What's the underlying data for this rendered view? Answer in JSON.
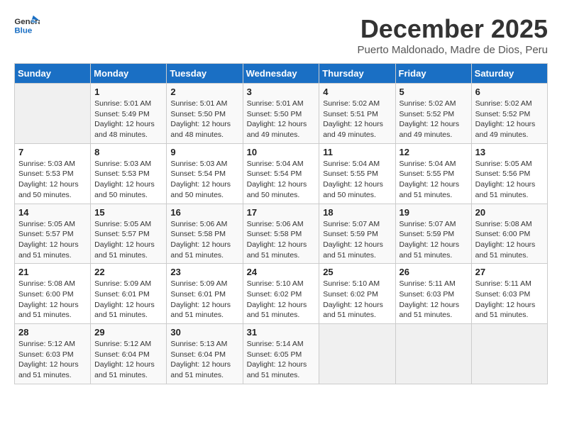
{
  "header": {
    "logo_line1": "General",
    "logo_line2": "Blue",
    "month": "December 2025",
    "location": "Puerto Maldonado, Madre de Dios, Peru"
  },
  "days_of_week": [
    "Sunday",
    "Monday",
    "Tuesday",
    "Wednesday",
    "Thursday",
    "Friday",
    "Saturday"
  ],
  "weeks": [
    [
      {
        "day": "",
        "info": ""
      },
      {
        "day": "1",
        "info": "Sunrise: 5:01 AM\nSunset: 5:49 PM\nDaylight: 12 hours\nand 48 minutes."
      },
      {
        "day": "2",
        "info": "Sunrise: 5:01 AM\nSunset: 5:50 PM\nDaylight: 12 hours\nand 48 minutes."
      },
      {
        "day": "3",
        "info": "Sunrise: 5:01 AM\nSunset: 5:50 PM\nDaylight: 12 hours\nand 49 minutes."
      },
      {
        "day": "4",
        "info": "Sunrise: 5:02 AM\nSunset: 5:51 PM\nDaylight: 12 hours\nand 49 minutes."
      },
      {
        "day": "5",
        "info": "Sunrise: 5:02 AM\nSunset: 5:52 PM\nDaylight: 12 hours\nand 49 minutes."
      },
      {
        "day": "6",
        "info": "Sunrise: 5:02 AM\nSunset: 5:52 PM\nDaylight: 12 hours\nand 49 minutes."
      }
    ],
    [
      {
        "day": "7",
        "info": "Sunrise: 5:03 AM\nSunset: 5:53 PM\nDaylight: 12 hours\nand 50 minutes."
      },
      {
        "day": "8",
        "info": "Sunrise: 5:03 AM\nSunset: 5:53 PM\nDaylight: 12 hours\nand 50 minutes."
      },
      {
        "day": "9",
        "info": "Sunrise: 5:03 AM\nSunset: 5:54 PM\nDaylight: 12 hours\nand 50 minutes."
      },
      {
        "day": "10",
        "info": "Sunrise: 5:04 AM\nSunset: 5:54 PM\nDaylight: 12 hours\nand 50 minutes."
      },
      {
        "day": "11",
        "info": "Sunrise: 5:04 AM\nSunset: 5:55 PM\nDaylight: 12 hours\nand 50 minutes."
      },
      {
        "day": "12",
        "info": "Sunrise: 5:04 AM\nSunset: 5:55 PM\nDaylight: 12 hours\nand 51 minutes."
      },
      {
        "day": "13",
        "info": "Sunrise: 5:05 AM\nSunset: 5:56 PM\nDaylight: 12 hours\nand 51 minutes."
      }
    ],
    [
      {
        "day": "14",
        "info": "Sunrise: 5:05 AM\nSunset: 5:57 PM\nDaylight: 12 hours\nand 51 minutes."
      },
      {
        "day": "15",
        "info": "Sunrise: 5:05 AM\nSunset: 5:57 PM\nDaylight: 12 hours\nand 51 minutes."
      },
      {
        "day": "16",
        "info": "Sunrise: 5:06 AM\nSunset: 5:58 PM\nDaylight: 12 hours\nand 51 minutes."
      },
      {
        "day": "17",
        "info": "Sunrise: 5:06 AM\nSunset: 5:58 PM\nDaylight: 12 hours\nand 51 minutes."
      },
      {
        "day": "18",
        "info": "Sunrise: 5:07 AM\nSunset: 5:59 PM\nDaylight: 12 hours\nand 51 minutes."
      },
      {
        "day": "19",
        "info": "Sunrise: 5:07 AM\nSunset: 5:59 PM\nDaylight: 12 hours\nand 51 minutes."
      },
      {
        "day": "20",
        "info": "Sunrise: 5:08 AM\nSunset: 6:00 PM\nDaylight: 12 hours\nand 51 minutes."
      }
    ],
    [
      {
        "day": "21",
        "info": "Sunrise: 5:08 AM\nSunset: 6:00 PM\nDaylight: 12 hours\nand 51 minutes."
      },
      {
        "day": "22",
        "info": "Sunrise: 5:09 AM\nSunset: 6:01 PM\nDaylight: 12 hours\nand 51 minutes."
      },
      {
        "day": "23",
        "info": "Sunrise: 5:09 AM\nSunset: 6:01 PM\nDaylight: 12 hours\nand 51 minutes."
      },
      {
        "day": "24",
        "info": "Sunrise: 5:10 AM\nSunset: 6:02 PM\nDaylight: 12 hours\nand 51 minutes."
      },
      {
        "day": "25",
        "info": "Sunrise: 5:10 AM\nSunset: 6:02 PM\nDaylight: 12 hours\nand 51 minutes."
      },
      {
        "day": "26",
        "info": "Sunrise: 5:11 AM\nSunset: 6:03 PM\nDaylight: 12 hours\nand 51 minutes."
      },
      {
        "day": "27",
        "info": "Sunrise: 5:11 AM\nSunset: 6:03 PM\nDaylight: 12 hours\nand 51 minutes."
      }
    ],
    [
      {
        "day": "28",
        "info": "Sunrise: 5:12 AM\nSunset: 6:03 PM\nDaylight: 12 hours\nand 51 minutes."
      },
      {
        "day": "29",
        "info": "Sunrise: 5:12 AM\nSunset: 6:04 PM\nDaylight: 12 hours\nand 51 minutes."
      },
      {
        "day": "30",
        "info": "Sunrise: 5:13 AM\nSunset: 6:04 PM\nDaylight: 12 hours\nand 51 minutes."
      },
      {
        "day": "31",
        "info": "Sunrise: 5:14 AM\nSunset: 6:05 PM\nDaylight: 12 hours\nand 51 minutes."
      },
      {
        "day": "",
        "info": ""
      },
      {
        "day": "",
        "info": ""
      },
      {
        "day": "",
        "info": ""
      }
    ]
  ]
}
